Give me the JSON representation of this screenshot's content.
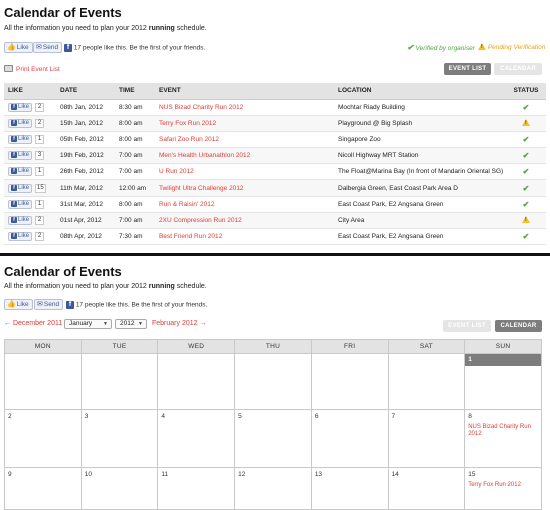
{
  "top": {
    "title": "Calendar of Events",
    "intro_before": "All the information you need to plan your 2012 ",
    "intro_bold": "running",
    "intro_after": " schedule.",
    "like_label": "Like",
    "send_label": "Send",
    "social_text": "17 people like this. Be the first of your friends.",
    "legend_verified": "Verified by organiser",
    "legend_pending": "Pending Verification",
    "print_label": "Print Event List",
    "event_list_btn": "EVENT LIST",
    "calendar_btn": "CALENDAR",
    "columns": [
      "LIKE",
      "DATE",
      "TIME",
      "EVENT",
      "LOCATION",
      "STATUS"
    ],
    "rows": [
      {
        "like": "Like",
        "count": "2",
        "date": "08th Jan, 2012",
        "time": "8:30 am",
        "event": "NUS Bizad Charity Run 2012",
        "location": "Mochtar Riady Building",
        "status": "verified"
      },
      {
        "like": "Like",
        "count": "2",
        "date": "15th Jan, 2012",
        "time": "8:00 am",
        "event": "Terry Fox Run 2012",
        "location": "Playground @ Big Splash",
        "status": "pending"
      },
      {
        "like": "Like",
        "count": "1",
        "date": "05th Feb, 2012",
        "time": "8:00 am",
        "event": "Safari Zoo Run 2012",
        "location": "Singapore Zoo",
        "status": "verified"
      },
      {
        "like": "Like",
        "count": "3",
        "date": "19th Feb, 2012",
        "time": "7:00 am",
        "event": "Men's Health Urbanathlon 2012",
        "location": "Nicoll Highway MRT Station",
        "status": "verified"
      },
      {
        "like": "Like",
        "count": "1",
        "date": "26th Feb, 2012",
        "time": "7:00 am",
        "event": "U Run 2012",
        "location": "The Float@Marina Bay (In front of Mandarin Oriental SG)",
        "status": "verified"
      },
      {
        "like": "Like",
        "count": "15",
        "date": "11th Mar, 2012",
        "time": "12:00 am",
        "event": "Twilight Ultra Challenge 2012",
        "location": "Dalbergia Green, East Coast Park Area D",
        "status": "verified"
      },
      {
        "like": "Like",
        "count": "1",
        "date": "31st Mar, 2012",
        "time": "8:00 am",
        "event": "Run & Raisin' 2012",
        "location": "East Coast Park, E2 Angsana Green",
        "status": "verified"
      },
      {
        "like": "Like",
        "count": "2",
        "date": "01st Apr, 2012",
        "time": "7:00 am",
        "event": "2XU Compression Run 2012",
        "location": "City Area",
        "status": "pending"
      },
      {
        "like": "Like",
        "count": "2",
        "date": "08th Apr, 2012",
        "time": "7:30 am",
        "event": "Best Friend Run 2012",
        "location": "East Coast Park, E2 Angsana Green",
        "status": "verified"
      }
    ]
  },
  "bottom": {
    "title": "Calendar of Events",
    "intro_before": "All the information you need to plan your 2012 ",
    "intro_bold": "running",
    "intro_after": " schedule.",
    "like_label": "Like",
    "send_label": "Send",
    "social_text": "17 people like this. Be the first of your friends.",
    "prev_month": "← December 2011",
    "month_select": "January",
    "year_select": "2012",
    "next_month": "February 2012 →",
    "event_list_btn": "EVENT LIST",
    "calendar_btn": "CALENDAR",
    "weekdays": [
      "MON",
      "TUE",
      "WED",
      "THU",
      "FRI",
      "SAT",
      "SUN"
    ],
    "weeks": [
      [
        "",
        "",
        "",
        "",
        "",
        "",
        "1"
      ],
      [
        "2",
        "3",
        "4",
        "5",
        "6",
        "7",
        "8"
      ],
      [
        "9",
        "10",
        "11",
        "12",
        "13",
        "14",
        "15"
      ]
    ],
    "events": [
      {
        "week": 1,
        "day": 6,
        "title": "NUS Bizad Charity Run 2012"
      },
      {
        "week": 2,
        "day": 6,
        "title": "Terry Fox Run 2012"
      }
    ]
  },
  "colors": {
    "accent_red": "#d9403a",
    "verified_green": "#4aa83a",
    "pending_amber": "#e2a21a",
    "button_grey": "#7d7d7d"
  },
  "icons": {
    "like": "facebook-like-icon",
    "send": "send-icon",
    "verified": "check-icon",
    "pending": "warning-triangle-icon",
    "print": "printer-icon"
  }
}
